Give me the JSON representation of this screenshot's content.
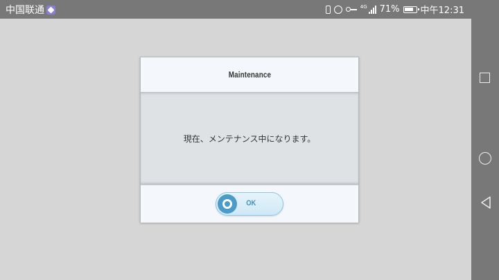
{
  "status_bar": {
    "carrier": "中国联通",
    "network": "4G",
    "battery": "71%",
    "time": "中午12:31"
  },
  "icons": {
    "carrier_badge": "app-badge-icon",
    "vibrate": "vibrate-icon",
    "alarm": "alarm-icon",
    "vpn": "key-icon",
    "signal": "signal-icon",
    "battery": "battery-icon",
    "nav_recent": "square-icon",
    "nav_home": "circle-icon",
    "nav_back": "back-triangle-icon"
  },
  "dialog": {
    "title": "Maintenance",
    "message": "現在、メンテナンス中になります。",
    "ok_label": "OK"
  },
  "colors": {
    "background": "#d6d6d6",
    "system_bars": "#787878",
    "accent": "#4b9bc8"
  }
}
